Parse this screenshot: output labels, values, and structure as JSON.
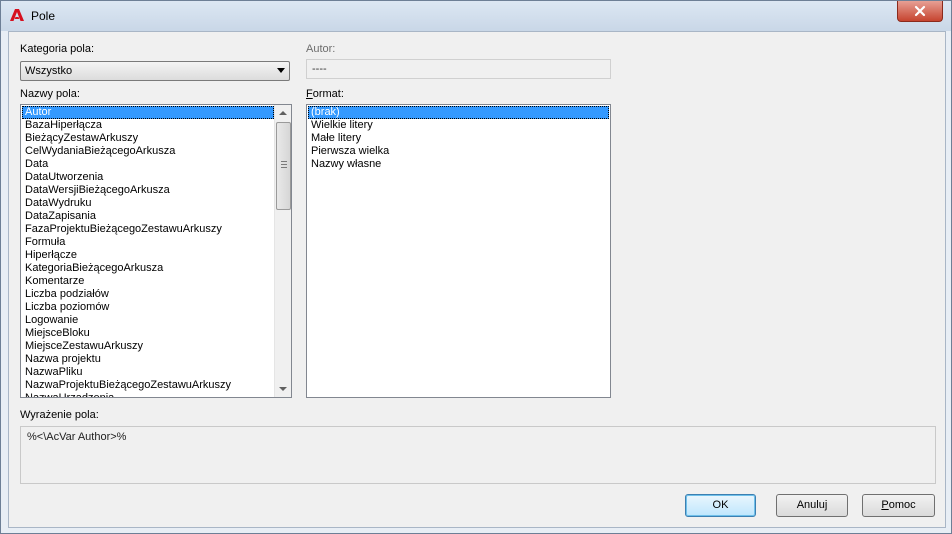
{
  "window": {
    "title": "Pole"
  },
  "category": {
    "label": "Kategoria pola:",
    "value": "Wszystko"
  },
  "author": {
    "label": "Autor:",
    "value": "----"
  },
  "field_names": {
    "label": "Nazwy pola:",
    "items": [
      "Autor",
      "BazaHiperłącza",
      "BieżącyZestawArkuszy",
      "CelWydaniaBieżącegoArkusza",
      "Data",
      "DataUtworzenia",
      "DataWersjiBieżącegoArkusza",
      "DataWydruku",
      "DataZapisania",
      "FazaProjektuBieżącegoZestawuArkuszy",
      "Formuła",
      "Hiperłącze",
      "KategoriaBieżącegoArkusza",
      "Komentarze",
      "Liczba podziałów",
      "Liczba poziomów",
      "Logowanie",
      "MiejsceBloku",
      "MiejsceZestawuArkuszy",
      "Nazwa projektu",
      "NazwaPliku",
      "NazwaProjektuBieżącegoZestawuArkuszy",
      "NazwaUrządzenia"
    ],
    "selected_index": 0
  },
  "format": {
    "label": "Format:",
    "items": [
      "(brak)",
      "Wielkie litery",
      "Małe litery",
      "Pierwsza wielka",
      "Nazwy własne"
    ],
    "selected_index": 0
  },
  "expression": {
    "label": "Wyrażenie pola:",
    "value": "%<\\AcVar Author>%"
  },
  "buttons": {
    "ok": "OK",
    "cancel": "Anuluj",
    "help": "Pomoc"
  },
  "colors": {
    "selection": "#3399ff",
    "close_button": "#c6442f",
    "app_icon": "#d6101f"
  }
}
